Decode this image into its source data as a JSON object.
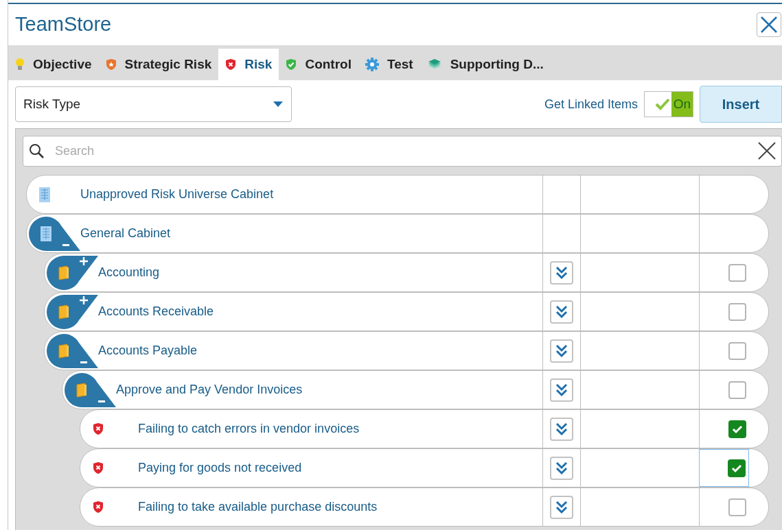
{
  "window": {
    "title": "TeamStore"
  },
  "tabs": [
    {
      "label": "Objective",
      "kind": "objective",
      "selected": false
    },
    {
      "label": "Strategic Risk",
      "kind": "strategic",
      "selected": false
    },
    {
      "label": "Risk",
      "kind": "risk",
      "selected": true
    },
    {
      "label": "Control",
      "kind": "control",
      "selected": false
    },
    {
      "label": "Test",
      "kind": "test",
      "selected": false
    },
    {
      "label": "Supporting D...",
      "kind": "supporting",
      "selected": false
    }
  ],
  "filter": {
    "value": "Risk Type"
  },
  "linked_items": {
    "label": "Get Linked Items",
    "state": "On",
    "on": true
  },
  "insert_button": "Insert",
  "search": {
    "placeholder": "Search"
  },
  "tree": [
    {
      "label": "Unapproved Risk Universe Cabinet",
      "kind": "cabinet"
    },
    {
      "label": "General Cabinet",
      "kind": "cabinet",
      "expanded": true,
      "children": [
        {
          "label": "Accounting",
          "kind": "folder",
          "expanded": false,
          "checked": false
        },
        {
          "label": "Accounts Receivable",
          "kind": "folder",
          "expanded": false,
          "checked": false
        },
        {
          "label": "Accounts Payable",
          "kind": "folder",
          "expanded": true,
          "checked": false,
          "children": [
            {
              "label": "Approve and Pay Vendor Invoices",
              "kind": "folder",
              "expanded": true,
              "checked": false,
              "children": [
                {
                  "label": "Failing to catch errors in vendor invoices",
                  "kind": "risk",
                  "checked": true,
                  "focused": false
                },
                {
                  "label": "Paying for goods not received",
                  "kind": "risk",
                  "checked": true,
                  "focused": true
                },
                {
                  "label": "Failing to take available purchase discounts",
                  "kind": "risk",
                  "checked": false,
                  "focused": false
                }
              ]
            }
          ]
        }
      ]
    }
  ]
}
